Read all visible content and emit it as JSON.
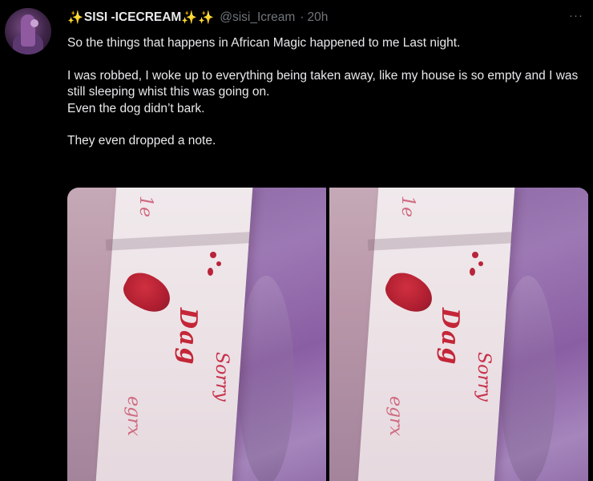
{
  "tweet": {
    "author": {
      "display_name": "SISI -ICECREAM",
      "handle": "@sisi_Icream",
      "time": "20h",
      "decorations": [
        "✨",
        "✨",
        "✨"
      ]
    },
    "icons": {
      "sparkles": "sparkles-icon",
      "more": "more-options-icon"
    },
    "text": {
      "line1": "So the things that happens in African Magic happened to me  Last night.",
      "line2": "I was robbed, I woke up to everything being taken away, like my house is so empty and I was still sleeping whist this was going on.",
      "line3": "Even the dog didn’t bark.",
      "line4": "They even dropped a note."
    },
    "more_glyph": "···",
    "media": {
      "count": 2,
      "accent_colors": {
        "ink": "#c42638",
        "cloth": "#8e6aa6",
        "paper": "#ece2e6"
      }
    }
  }
}
